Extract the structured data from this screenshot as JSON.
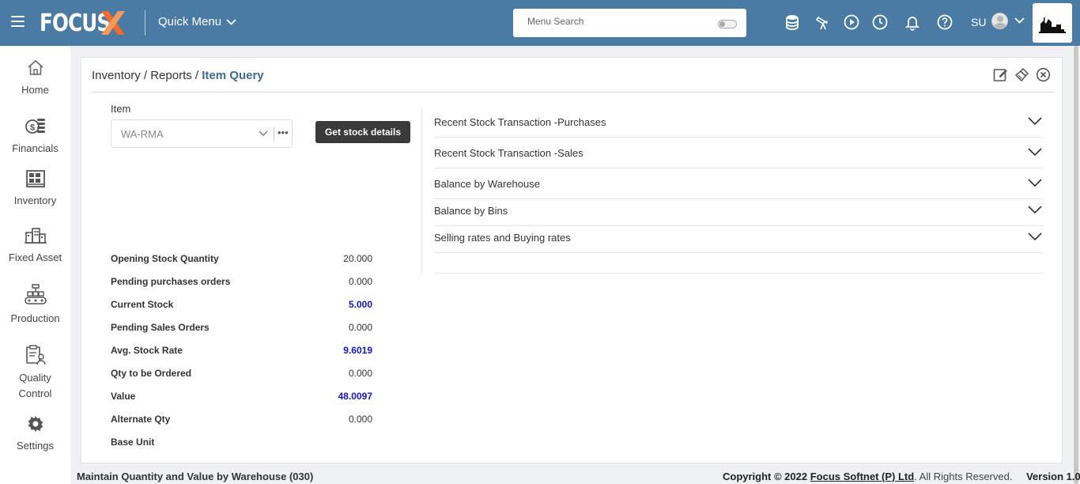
{
  "header": {
    "logo_text": "FOCUS",
    "quick_menu_label": "Quick Menu",
    "search_placeholder": "Menu Search",
    "user_initials": "SU"
  },
  "sidebar": {
    "items": [
      {
        "label": "Home",
        "icon": "home-icon"
      },
      {
        "label": "Financials",
        "icon": "coins-icon"
      },
      {
        "label": "Inventory",
        "icon": "warehouse-icon"
      },
      {
        "label": "Fixed Asset",
        "icon": "buildings-icon"
      },
      {
        "label": "Production",
        "icon": "conveyor-icon"
      },
      {
        "label": "Quality Control",
        "icon": "clipboard-user-icon"
      },
      {
        "label": "Settings",
        "icon": "gear-icon"
      }
    ]
  },
  "breadcrumb": {
    "part1": "Inventory",
    "sep": "/",
    "part2": "Reports",
    "current": "Item Query"
  },
  "form": {
    "item_label": "Item",
    "item_value": "WA-RMA",
    "more_glyph": "•••",
    "get_button": "Get stock details"
  },
  "stats": [
    {
      "label": "Opening Stock Quantity",
      "value": "20.000",
      "highlight": false
    },
    {
      "label": "Pending purchases orders",
      "value": "0.000",
      "highlight": false
    },
    {
      "label": "Current Stock",
      "value": "5.000",
      "highlight": true
    },
    {
      "label": "Pending Sales Orders",
      "value": "0.000",
      "highlight": false
    },
    {
      "label": "Avg. Stock Rate",
      "value": "9.6019",
      "highlight": true
    },
    {
      "label": "Qty to be Ordered",
      "value": "0.000",
      "highlight": false
    },
    {
      "label": "Value",
      "value": "48.0097",
      "highlight": true
    },
    {
      "label": "Alternate Qty",
      "value": "0.000",
      "highlight": false
    },
    {
      "label": "Base Unit",
      "value": "",
      "highlight": false
    }
  ],
  "accordion": [
    {
      "title": "Recent Stock Transaction -Purchases"
    },
    {
      "title": "Recent Stock Transaction -Sales"
    },
    {
      "title": "Balance by Warehouse"
    },
    {
      "title": "Balance by Bins"
    },
    {
      "title": "Selling rates and Buying rates"
    }
  ],
  "footer": {
    "screen_name": "Maintain Quantity and Value by Warehouse (030)",
    "copyright_prefix": "Copyright © 2022",
    "company": "Focus Softnet (P) Ltd",
    "rights": ". All Rights Reserved.",
    "version": "Version 1.0"
  },
  "colors": {
    "topbar": "#4a7ba5",
    "accent_x": "#f26b2a",
    "highlight_value": "#1414c8",
    "breadcrumb_current": "#3d6a93"
  }
}
